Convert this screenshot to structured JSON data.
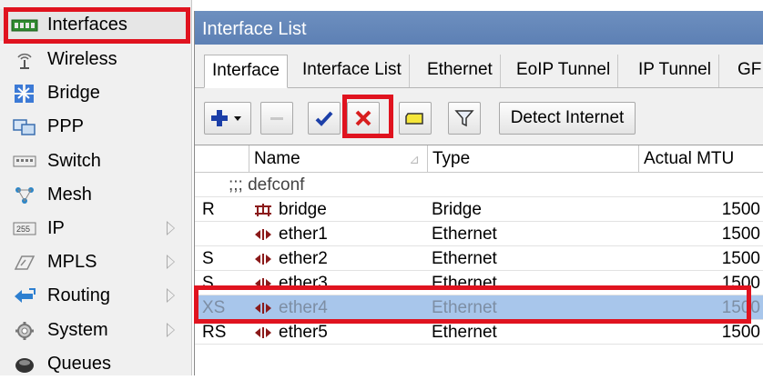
{
  "sidebar": {
    "items": [
      {
        "label": "Interfaces",
        "icon": "interfaces-icon",
        "submenu": false
      },
      {
        "label": "Wireless",
        "icon": "wireless-icon",
        "submenu": false
      },
      {
        "label": "Bridge",
        "icon": "bridge-icon",
        "submenu": false
      },
      {
        "label": "PPP",
        "icon": "ppp-icon",
        "submenu": false
      },
      {
        "label": "Switch",
        "icon": "switch-icon",
        "submenu": false
      },
      {
        "label": "Mesh",
        "icon": "mesh-icon",
        "submenu": false
      },
      {
        "label": "IP",
        "icon": "ip-icon",
        "submenu": true
      },
      {
        "label": "MPLS",
        "icon": "mpls-icon",
        "submenu": true
      },
      {
        "label": "Routing",
        "icon": "routing-icon",
        "submenu": true
      },
      {
        "label": "System",
        "icon": "system-icon",
        "submenu": true
      },
      {
        "label": "Queues",
        "icon": "queues-icon",
        "submenu": false
      }
    ]
  },
  "window": {
    "title": "Interface List",
    "tabs": [
      "Interface",
      "Interface List",
      "Ethernet",
      "EoIP Tunnel",
      "IP Tunnel",
      "GF"
    ],
    "toolbar": {
      "detect_label": "Detect Internet"
    },
    "columns": [
      "",
      "Name",
      "Type",
      "Actual MTU"
    ],
    "group_label": ";;; defconf",
    "rows": [
      {
        "flags": "R",
        "name": "bridge",
        "type": "Bridge",
        "mtu": "1500",
        "icon": "bridge-if-icon"
      },
      {
        "flags": "",
        "name": "ether1",
        "type": "Ethernet",
        "mtu": "1500",
        "icon": "ethernet-if-icon"
      },
      {
        "flags": "S",
        "name": "ether2",
        "type": "Ethernet",
        "mtu": "1500",
        "icon": "ethernet-if-icon"
      },
      {
        "flags": "S",
        "name": "ether3",
        "type": "Ethernet",
        "mtu": "1500",
        "icon": "ethernet-if-icon"
      },
      {
        "flags": "XS",
        "name": "ether4",
        "type": "Ethernet",
        "mtu": "1500",
        "icon": "ethernet-if-icon"
      },
      {
        "flags": "RS",
        "name": "ether5",
        "type": "Ethernet",
        "mtu": "1500",
        "icon": "ethernet-if-icon"
      }
    ]
  },
  "colors": {
    "highlight": "#e0131f",
    "titlebar": "#5d80b4",
    "selected_row": "#a8c6eb",
    "remove_icon": "#d81e1e",
    "add_icon": "#1c3fa8"
  }
}
